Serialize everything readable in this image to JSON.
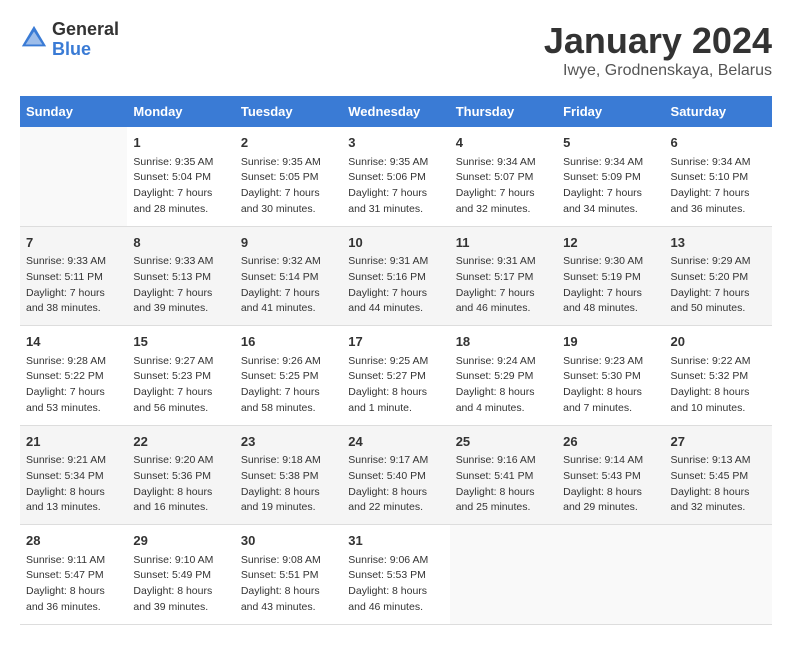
{
  "logo": {
    "general": "General",
    "blue": "Blue"
  },
  "title": "January 2024",
  "location": "Iwye, Grodnenskaya, Belarus",
  "days_of_week": [
    "Sunday",
    "Monday",
    "Tuesday",
    "Wednesday",
    "Thursday",
    "Friday",
    "Saturday"
  ],
  "weeks": [
    [
      {
        "day": "",
        "sunrise": "",
        "sunset": "",
        "daylight": ""
      },
      {
        "day": "1",
        "sunrise": "Sunrise: 9:35 AM",
        "sunset": "Sunset: 5:04 PM",
        "daylight": "Daylight: 7 hours and 28 minutes."
      },
      {
        "day": "2",
        "sunrise": "Sunrise: 9:35 AM",
        "sunset": "Sunset: 5:05 PM",
        "daylight": "Daylight: 7 hours and 30 minutes."
      },
      {
        "day": "3",
        "sunrise": "Sunrise: 9:35 AM",
        "sunset": "Sunset: 5:06 PM",
        "daylight": "Daylight: 7 hours and 31 minutes."
      },
      {
        "day": "4",
        "sunrise": "Sunrise: 9:34 AM",
        "sunset": "Sunset: 5:07 PM",
        "daylight": "Daylight: 7 hours and 32 minutes."
      },
      {
        "day": "5",
        "sunrise": "Sunrise: 9:34 AM",
        "sunset": "Sunset: 5:09 PM",
        "daylight": "Daylight: 7 hours and 34 minutes."
      },
      {
        "day": "6",
        "sunrise": "Sunrise: 9:34 AM",
        "sunset": "Sunset: 5:10 PM",
        "daylight": "Daylight: 7 hours and 36 minutes."
      }
    ],
    [
      {
        "day": "7",
        "sunrise": "Sunrise: 9:33 AM",
        "sunset": "Sunset: 5:11 PM",
        "daylight": "Daylight: 7 hours and 38 minutes."
      },
      {
        "day": "8",
        "sunrise": "Sunrise: 9:33 AM",
        "sunset": "Sunset: 5:13 PM",
        "daylight": "Daylight: 7 hours and 39 minutes."
      },
      {
        "day": "9",
        "sunrise": "Sunrise: 9:32 AM",
        "sunset": "Sunset: 5:14 PM",
        "daylight": "Daylight: 7 hours and 41 minutes."
      },
      {
        "day": "10",
        "sunrise": "Sunrise: 9:31 AM",
        "sunset": "Sunset: 5:16 PM",
        "daylight": "Daylight: 7 hours and 44 minutes."
      },
      {
        "day": "11",
        "sunrise": "Sunrise: 9:31 AM",
        "sunset": "Sunset: 5:17 PM",
        "daylight": "Daylight: 7 hours and 46 minutes."
      },
      {
        "day": "12",
        "sunrise": "Sunrise: 9:30 AM",
        "sunset": "Sunset: 5:19 PM",
        "daylight": "Daylight: 7 hours and 48 minutes."
      },
      {
        "day": "13",
        "sunrise": "Sunrise: 9:29 AM",
        "sunset": "Sunset: 5:20 PM",
        "daylight": "Daylight: 7 hours and 50 minutes."
      }
    ],
    [
      {
        "day": "14",
        "sunrise": "Sunrise: 9:28 AM",
        "sunset": "Sunset: 5:22 PM",
        "daylight": "Daylight: 7 hours and 53 minutes."
      },
      {
        "day": "15",
        "sunrise": "Sunrise: 9:27 AM",
        "sunset": "Sunset: 5:23 PM",
        "daylight": "Daylight: 7 hours and 56 minutes."
      },
      {
        "day": "16",
        "sunrise": "Sunrise: 9:26 AM",
        "sunset": "Sunset: 5:25 PM",
        "daylight": "Daylight: 7 hours and 58 minutes."
      },
      {
        "day": "17",
        "sunrise": "Sunrise: 9:25 AM",
        "sunset": "Sunset: 5:27 PM",
        "daylight": "Daylight: 8 hours and 1 minute."
      },
      {
        "day": "18",
        "sunrise": "Sunrise: 9:24 AM",
        "sunset": "Sunset: 5:29 PM",
        "daylight": "Daylight: 8 hours and 4 minutes."
      },
      {
        "day": "19",
        "sunrise": "Sunrise: 9:23 AM",
        "sunset": "Sunset: 5:30 PM",
        "daylight": "Daylight: 8 hours and 7 minutes."
      },
      {
        "day": "20",
        "sunrise": "Sunrise: 9:22 AM",
        "sunset": "Sunset: 5:32 PM",
        "daylight": "Daylight: 8 hours and 10 minutes."
      }
    ],
    [
      {
        "day": "21",
        "sunrise": "Sunrise: 9:21 AM",
        "sunset": "Sunset: 5:34 PM",
        "daylight": "Daylight: 8 hours and 13 minutes."
      },
      {
        "day": "22",
        "sunrise": "Sunrise: 9:20 AM",
        "sunset": "Sunset: 5:36 PM",
        "daylight": "Daylight: 8 hours and 16 minutes."
      },
      {
        "day": "23",
        "sunrise": "Sunrise: 9:18 AM",
        "sunset": "Sunset: 5:38 PM",
        "daylight": "Daylight: 8 hours and 19 minutes."
      },
      {
        "day": "24",
        "sunrise": "Sunrise: 9:17 AM",
        "sunset": "Sunset: 5:40 PM",
        "daylight": "Daylight: 8 hours and 22 minutes."
      },
      {
        "day": "25",
        "sunrise": "Sunrise: 9:16 AM",
        "sunset": "Sunset: 5:41 PM",
        "daylight": "Daylight: 8 hours and 25 minutes."
      },
      {
        "day": "26",
        "sunrise": "Sunrise: 9:14 AM",
        "sunset": "Sunset: 5:43 PM",
        "daylight": "Daylight: 8 hours and 29 minutes."
      },
      {
        "day": "27",
        "sunrise": "Sunrise: 9:13 AM",
        "sunset": "Sunset: 5:45 PM",
        "daylight": "Daylight: 8 hours and 32 minutes."
      }
    ],
    [
      {
        "day": "28",
        "sunrise": "Sunrise: 9:11 AM",
        "sunset": "Sunset: 5:47 PM",
        "daylight": "Daylight: 8 hours and 36 minutes."
      },
      {
        "day": "29",
        "sunrise": "Sunrise: 9:10 AM",
        "sunset": "Sunset: 5:49 PM",
        "daylight": "Daylight: 8 hours and 39 minutes."
      },
      {
        "day": "30",
        "sunrise": "Sunrise: 9:08 AM",
        "sunset": "Sunset: 5:51 PM",
        "daylight": "Daylight: 8 hours and 43 minutes."
      },
      {
        "day": "31",
        "sunrise": "Sunrise: 9:06 AM",
        "sunset": "Sunset: 5:53 PM",
        "daylight": "Daylight: 8 hours and 46 minutes."
      },
      {
        "day": "",
        "sunrise": "",
        "sunset": "",
        "daylight": ""
      },
      {
        "day": "",
        "sunrise": "",
        "sunset": "",
        "daylight": ""
      },
      {
        "day": "",
        "sunrise": "",
        "sunset": "",
        "daylight": ""
      }
    ]
  ]
}
